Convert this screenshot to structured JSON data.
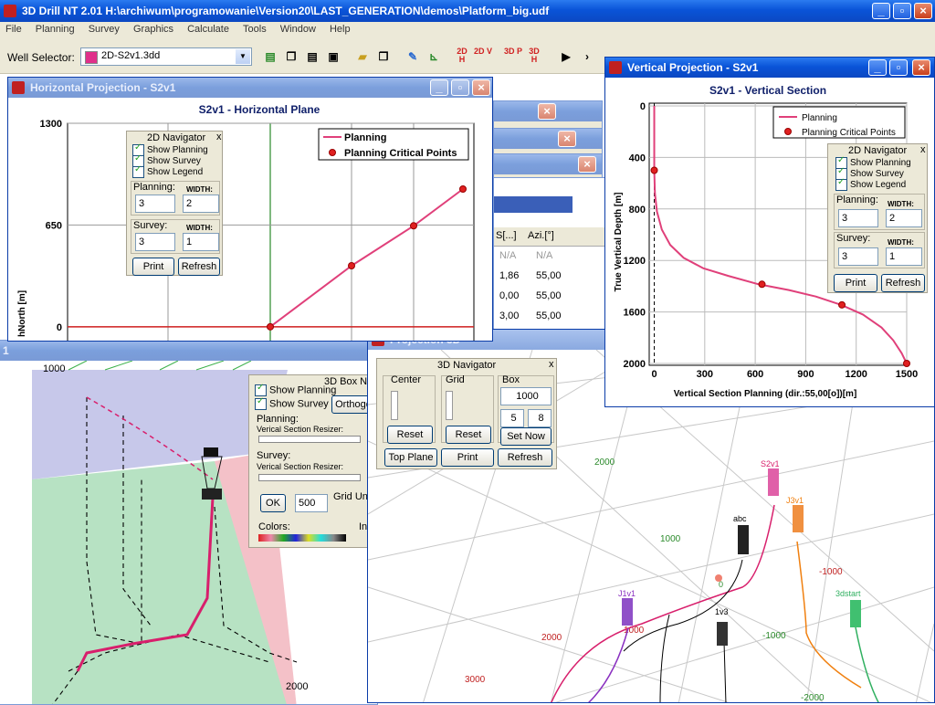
{
  "app": {
    "title": "3D Drill NT 2.01  H:\\archiwum\\programowanie\\Version20\\LAST_GENERATION\\demos\\Platform_big.udf",
    "menu": [
      "File",
      "Planning",
      "Survey",
      "Graphics",
      "Calculate",
      "Tools",
      "Window",
      "Help"
    ],
    "well_selector_label": "Well Selector:",
    "well_selector_value": "2D-S2v1.3dd",
    "well_color": "#e0308a"
  },
  "toolbar_icons": [
    "new-icon",
    "copy-icon",
    "paste-icon",
    "save-icon",
    "open-icon",
    "copy-all-icon",
    "edit-icon",
    "chart-icon",
    "2d-h-icon",
    "2d-v-icon",
    "3d-p-icon",
    "3d-h-icon",
    "play-icon",
    "next-icon"
  ],
  "toolbar_text": {
    "b2dh": "2D H",
    "b2dv": "2D V",
    "b3dp": "3D P",
    "b3dh": "3D H",
    "play": "▶",
    "next": "›"
  },
  "horizontal": {
    "title": "Horizontal Projection - S2v1",
    "chart_title": "S2v1 - Horizontal Plane",
    "ylabel_fragment": "hNorth [m]",
    "legend": {
      "planning": "Planning",
      "critical": "Planning Critical Points"
    }
  },
  "vertical": {
    "title": "Vertical Projection - S2v1",
    "chart_title": "S2v1 - Vertical Section",
    "legend": {
      "planning": "Planning",
      "critical": "Planning Critical Points"
    }
  },
  "navigator2d": {
    "title": "2D Navigator",
    "close": "x",
    "show_planning": "Show Planning",
    "show_survey": "Show Survey",
    "show_legend": "Show Legend",
    "planning_label": "Planning:",
    "survey_label": "Survey:",
    "width_label": "WIDTH:",
    "planning_value": "3",
    "planning_width": "2",
    "survey_value": "3",
    "survey_width": "1",
    "print": "Print",
    "refresh": "Refresh"
  },
  "table": {
    "headers": [
      "S[...]",
      "Azi.[°]"
    ],
    "rows": [
      [
        "N/A",
        "N/A"
      ],
      [
        "1,86",
        "55,00"
      ],
      [
        "0,00",
        "55,00"
      ],
      [
        "3,00",
        "55,00"
      ]
    ]
  },
  "projection3d": {
    "title": "Projection 3D",
    "left_window_number": "1",
    "labels": {
      "y1000": "1000",
      "y2000": "2000",
      "z2000": "2000",
      "z1000": "1000",
      "zm1000": "-1000",
      "zm2000": "-2000",
      "g1000": "1000",
      "g2000": "2000",
      "g3000": "3000",
      "gm1000": "-1000",
      "zero": "0"
    },
    "wells": [
      "S2v1",
      "J3v1",
      "abc",
      "J1v1",
      "1v3",
      "3dstart"
    ]
  },
  "nav3d": {
    "title": "3D Navigator",
    "close": "x",
    "center": "Center",
    "grid": "Grid",
    "box": "Box",
    "box_value": "1000",
    "val_a": "5",
    "val_b": "8",
    "reset1": "Reset",
    "reset2": "Reset",
    "set_now": "Set Now",
    "top_plane": "Top Plane",
    "print": "Print",
    "refresh": "Refresh"
  },
  "boxnav": {
    "title": "3D Box Na",
    "show_planning": "Show Planning",
    "show_survey": "Show Survey",
    "ortho": "Orthogo",
    "planning": "Planning:",
    "vsr1": "Verical Section Resizer:",
    "survey": "Survey:",
    "vsr2": "Verical Section Resizer:",
    "ok": "OK",
    "value": "500",
    "grid_unit": "Grid Uni",
    "colors": "Colors:",
    "in": "In"
  },
  "chart_data": [
    {
      "type": "line",
      "title": "S2v1 - Horizontal Plane",
      "ylabel": "hNorth [m]",
      "y_ticks": [
        0,
        650,
        1300
      ],
      "series": [
        {
          "name": "Planning",
          "x": [
            0,
            1,
            2,
            3
          ],
          "y": [
            0,
            390,
            645,
            880
          ]
        },
        {
          "name": "Planning Critical Points",
          "x": [
            0,
            1,
            2,
            3
          ],
          "y": [
            0,
            390,
            645,
            880
          ]
        }
      ]
    },
    {
      "type": "line",
      "title": "S2v1 - Vertical Section",
      "xlabel": "Vertical Section Planning (dir.:55,00[o])[m]",
      "ylabel": "True Vertical Depth [m]",
      "x_ticks": [
        0,
        300,
        600,
        900,
        1200,
        1500
      ],
      "y_ticks": [
        0,
        400,
        800,
        1200,
        1600,
        2000
      ],
      "xlim": [
        -30,
        1500
      ],
      "ylim": [
        2000,
        0
      ],
      "series": [
        {
          "name": "Planning",
          "x": [
            0,
            0,
            4,
            16,
            45,
            95,
            175,
            290,
            440,
            620,
            800,
            960,
            1110,
            1240,
            1350,
            1420,
            1470,
            1500
          ],
          "y": [
            0,
            500,
            680,
            820,
            960,
            1080,
            1180,
            1260,
            1320,
            1385,
            1430,
            1480,
            1545,
            1620,
            1720,
            1820,
            1920,
            2000
          ]
        },
        {
          "name": "Planning Critical Points",
          "x": [
            0,
            640,
            1115,
            1500
          ],
          "y": [
            500,
            1385,
            1545,
            2000
          ]
        }
      ]
    }
  ]
}
